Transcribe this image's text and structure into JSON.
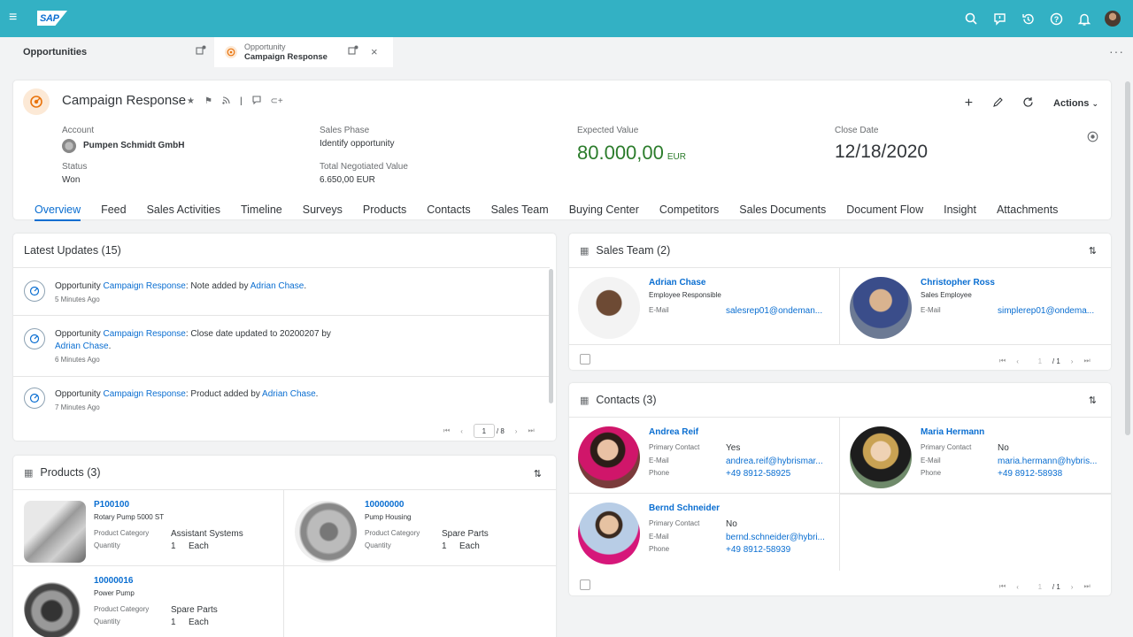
{
  "brand": {
    "logo_text": "SAP",
    "accent": "#33b1c4",
    "link": "#0a6ed1",
    "positive": "#2b7c2b"
  },
  "shell": {
    "icons": [
      "menu-icon",
      "search-icon",
      "feedback-icon",
      "history-icon",
      "help-icon",
      "bell-icon",
      "user-avatar"
    ]
  },
  "tabs": {
    "tab1": {
      "label": "Opportunities"
    },
    "tab2": {
      "type": "Opportunity",
      "label": "Campaign Response",
      "close": "×"
    }
  },
  "more": "···",
  "header": {
    "title": "Campaign Response",
    "actions_label": "Actions",
    "account_label": "Account",
    "account_value": "Pumpen Schmidt GmbH",
    "status_label": "Status",
    "status_value": "Won",
    "phase_label": "Sales Phase",
    "phase_value": "Identify opportunity",
    "tnv_label": "Total Negotiated Value",
    "tnv_value": "6.650,00  EUR",
    "ev_label": "Expected Value",
    "ev_value": "80.000,00",
    "ev_unit": "EUR",
    "close_label": "Close Date",
    "close_value": "12/18/2020"
  },
  "sections": [
    "Overview",
    "Feed",
    "Sales Activities",
    "Timeline",
    "Surveys",
    "Products",
    "Contacts",
    "Sales Team",
    "Buying Center",
    "Competitors",
    "Sales Documents",
    "Document Flow",
    "Insight",
    "Attachments"
  ],
  "updates": {
    "title": "Latest Updates  (15)",
    "items": [
      {
        "pre": "Opportunity ",
        "link": "Campaign Response",
        "mid": ": Note added by ",
        "user": "Adrian Chase",
        "post": ".",
        "time": "5 Minutes Ago"
      },
      {
        "pre": "Opportunity ",
        "link": "Campaign Response",
        "mid": ": Close date updated to 20200207 by ",
        "user": "Adrian Chase",
        "post": ".",
        "time": "6 Minutes Ago"
      },
      {
        "pre": "Opportunity ",
        "link": "Campaign Response",
        "mid": ": Product added by ",
        "user": "Adrian Chase",
        "post": ".",
        "time": "7 Minutes Ago"
      }
    ],
    "page": "1",
    "pages": "/ 8"
  },
  "products": {
    "title": "Products   (3)",
    "items": [
      {
        "id": "P100100",
        "name": "Rotary Pump 5000 ST",
        "cat_label": "Product Category",
        "cat": "Assistant Systems",
        "qty_label": "Quantity",
        "qty": "1",
        "unit": "Each"
      },
      {
        "id": "10000000",
        "name": "Pump Housing",
        "cat_label": "Product Category",
        "cat": "Spare Parts",
        "qty_label": "Quantity",
        "qty": "1",
        "unit": "Each"
      },
      {
        "id": "10000016",
        "name": "Power Pump",
        "cat_label": "Product Category",
        "cat": "Spare Parts",
        "qty_label": "Quantity",
        "qty": "1",
        "unit": "Each"
      }
    ]
  },
  "salesteam": {
    "title": "Sales Team   (2)",
    "members": [
      {
        "name": "Adrian Chase",
        "role": "Employee Responsible",
        "email_label": "E-Mail",
        "email": "salesrep01@ondeman..."
      },
      {
        "name": "Christopher Ross",
        "role": "Sales Employee",
        "email_label": "E-Mail",
        "email": "simplerep01@ondema..."
      }
    ],
    "page": "1",
    "pages": "/ 1"
  },
  "contacts": {
    "title": "Contacts   (3)",
    "items": [
      {
        "name": "Andrea Reif",
        "pc_label": "Primary Contact",
        "pc": "Yes",
        "email_label": "E-Mail",
        "email": "andrea.reif@hybrismar...",
        "phone_label": "Phone",
        "phone": "+49 8912-58925"
      },
      {
        "name": "Maria Hermann",
        "pc_label": "Primary Contact",
        "pc": "No",
        "email_label": "E-Mail",
        "email": "maria.hermann@hybris...",
        "phone_label": "Phone",
        "phone": "+49 8912-58938"
      },
      {
        "name": "Bernd Schneider",
        "pc_label": "Primary Contact",
        "pc": "No",
        "email_label": "E-Mail",
        "email": "bernd.schneider@hybri...",
        "phone_label": "Phone",
        "phone": "+49 8912-58939"
      }
    ],
    "page": "1",
    "pages": "/ 1"
  }
}
